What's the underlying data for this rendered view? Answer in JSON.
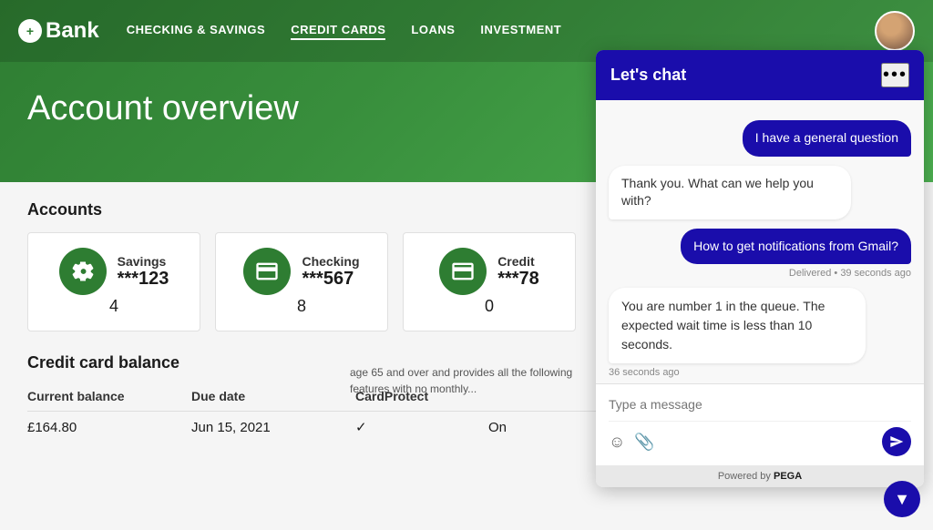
{
  "nav": {
    "logo_icon": "+",
    "logo_text": "Bank",
    "links": [
      {
        "label": "CHECKING & SAVINGS",
        "active": false
      },
      {
        "label": "CREDIT CARDS",
        "active": true
      },
      {
        "label": "LOANS",
        "active": false
      },
      {
        "label": "INVESTMENT",
        "active": false
      }
    ]
  },
  "hero": {
    "title": "Account overview"
  },
  "accounts_section": {
    "title": "Accounts",
    "accounts": [
      {
        "type": "Savings",
        "number": "***123",
        "suffix": "4",
        "icon": "piggy-bank"
      },
      {
        "type": "Checking",
        "number": "***567",
        "suffix": "8",
        "icon": "cash"
      },
      {
        "type": "Credit",
        "number": "***78",
        "suffix": "0",
        "icon": "credit-card"
      }
    ]
  },
  "credit_balance": {
    "title": "Credit card balance",
    "headers": [
      "Current balance",
      "Due date",
      "CardProtect"
    ],
    "row": {
      "balance": "£164.80",
      "due_date": "Jun 15, 2021",
      "protect": "On"
    }
  },
  "chat": {
    "header_title": "Let's chat",
    "menu_icon": "•••",
    "messages": [
      {
        "type": "user",
        "text": "I have a general question"
      },
      {
        "type": "bot",
        "text": "Thank you. What can we help you with?"
      },
      {
        "type": "user",
        "text": "How to get notifications from Gmail?"
      },
      {
        "type": "timestamp",
        "text": "Delivered • 39 seconds ago"
      },
      {
        "type": "bot_queue",
        "text": "You are number 1 in the queue. The expected wait time is less than 10 seconds."
      },
      {
        "type": "timestamp_left",
        "text": "36 seconds ago"
      }
    ],
    "input_placeholder": "Type a message",
    "footer": "Powered by ",
    "footer_brand": "PEGA"
  },
  "partial_content": "age 65 and over and provides all the following features with no monthly..."
}
